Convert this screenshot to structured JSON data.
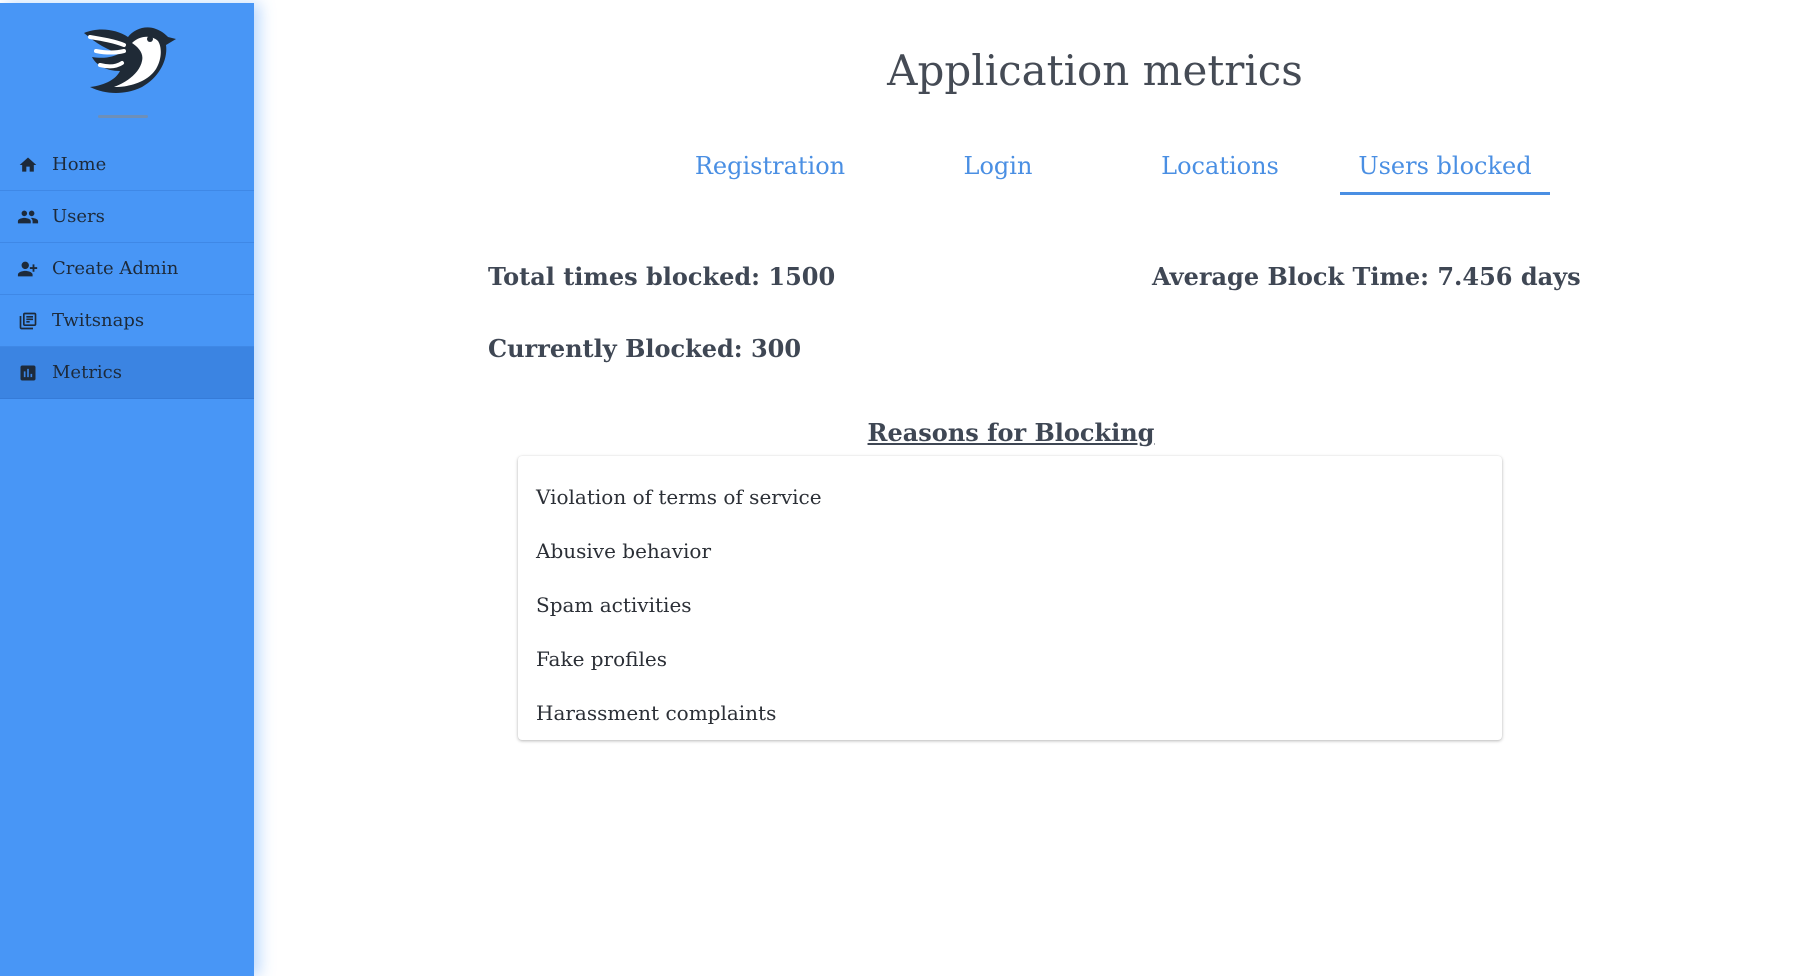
{
  "sidebar": {
    "logo": "bird-logo",
    "items": [
      {
        "label": "Home",
        "icon": "home-icon",
        "active": false
      },
      {
        "label": "Users",
        "icon": "users-icon",
        "active": false
      },
      {
        "label": "Create Admin",
        "icon": "add-user-icon",
        "active": false
      },
      {
        "label": "Twitsnaps",
        "icon": "photo-library-icon",
        "active": false
      },
      {
        "label": "Metrics",
        "icon": "bar-chart-icon",
        "active": true
      }
    ]
  },
  "main": {
    "title": "Application metrics",
    "tabs": [
      {
        "label": "Registration",
        "active": false
      },
      {
        "label": "Login",
        "active": false
      },
      {
        "label": "Locations",
        "active": false
      },
      {
        "label": "Users blocked",
        "active": true
      }
    ],
    "stats": {
      "total_blocked": "Total times blocked: 1500",
      "average_block_time": "Average Block Time: 7.456 days",
      "currently_blocked": "Currently Blocked: 300"
    },
    "reasons": {
      "title": "Reasons for Blocking",
      "items": [
        "Violation of terms of service",
        "Abusive behavior",
        "Spam activities",
        "Fake profiles",
        "Harassment complaints"
      ]
    }
  },
  "colors": {
    "sidebar_bg": "#4896f6",
    "sidebar_active": "#3b84e2",
    "accent": "#4a8fe3",
    "text": "#3f4754"
  }
}
